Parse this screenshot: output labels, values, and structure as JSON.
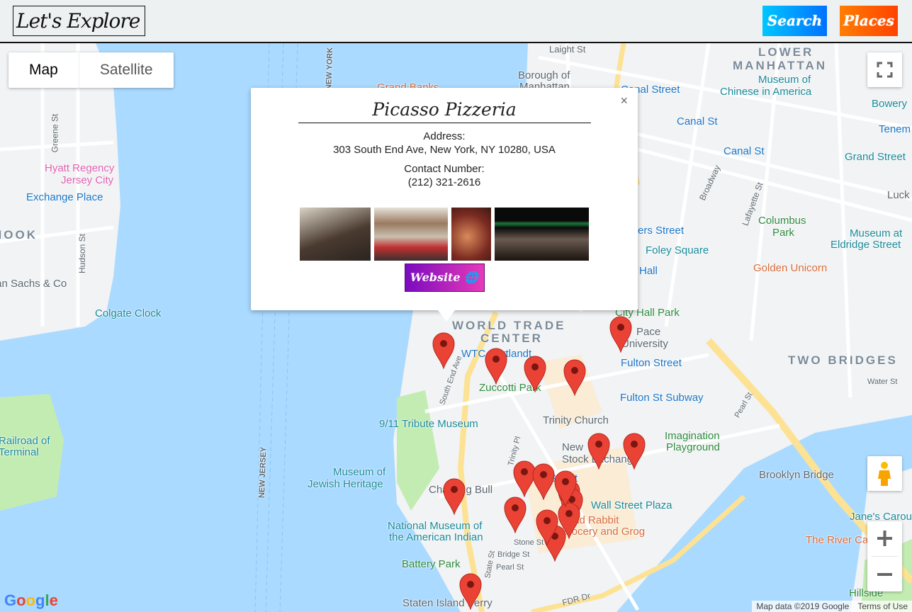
{
  "header": {
    "logo": "Let's Explore",
    "search_label": "Search",
    "places_label": "Places"
  },
  "map_type": {
    "map": "Map",
    "satellite": "Satellite",
    "selected": "Map"
  },
  "popup": {
    "title": "Picasso Pizzeria",
    "address_label": "Address:",
    "address": "303 South End Ave, New York, NY 10280, USA",
    "contact_label": "Contact Number:",
    "contact": "(212) 321-2616",
    "website_label": "Website",
    "close": "×",
    "photos": [
      "dining-room",
      "pizza-counter",
      "pizza-slice",
      "storefront-night"
    ]
  },
  "map_labels": [
    "LOWER",
    "MANHATTAN",
    "Museum of",
    "Chinese in America",
    "Bowery",
    "Canal Street",
    "Canal St",
    "Canal St",
    "Grand Street",
    "Columbus",
    "Park",
    "Foley Square",
    "Museum at",
    "Eldridge Street",
    "Golden Unicorn",
    "City Hall Park",
    "Pace",
    "University",
    "TWO BRIDGES",
    "WORLD TRADE",
    "CENTER",
    "Fulton Street",
    "Fulton St Subway",
    "Zuccotti Park",
    "Trinity Church",
    "9/11 Tribute Museum",
    "Imagination",
    "Playground",
    "Brooklyn Bridge",
    "Wall Street Plaza",
    "The Dead Rabbit",
    "Grocery and Grog",
    "Museum of",
    "Jewish Heritage",
    "Charging Bull",
    "National Museum of",
    "the American Indian",
    "Battery Park",
    "Staten Island Ferry",
    "Jane's Carousel",
    "The River Cafe",
    "Hillside",
    "Hyatt Regency",
    "Jersey City",
    "Exchange Place",
    "Goldman Sachs & Co",
    "Colgate Clock",
    "Railroad of",
    "Terminal",
    "Grand Banks",
    "Borough of",
    "Manhattan",
    "Laight St",
    "Brooklyn Bridge",
    "Tenem",
    "Luck",
    "Stone St",
    "Bridge St",
    "Pearl St",
    "FDR Dr",
    "Broadway",
    "Lafayette St",
    "Hudson St",
    "Greene St",
    "South End Ave",
    "Trinity Pl",
    "State St",
    "Water St",
    "Pearl St",
    "NEW JERSEY",
    "NEW YORK",
    "HOOK",
    "Street",
    "New",
    "Stock Exchange",
    "WTC Cortlandt",
    "ers Street",
    "Hall"
  ],
  "attribution": {
    "map_data": "Map data ©2019 Google",
    "terms": "Terms of Use",
    "google": "Google"
  },
  "colors": {
    "water": "#aadaff",
    "land": "#f1f3f4",
    "park": "#c3ecb2",
    "pin": "#ea4335",
    "highway": "#fde293",
    "search_gradient": [
      "#00c6ff",
      "#0072ff"
    ],
    "places_gradient": [
      "#ff7e00",
      "#ff4200"
    ],
    "website_gradient": [
      "#7a0bc0",
      "#e83ab7"
    ]
  },
  "markers_count": 18
}
